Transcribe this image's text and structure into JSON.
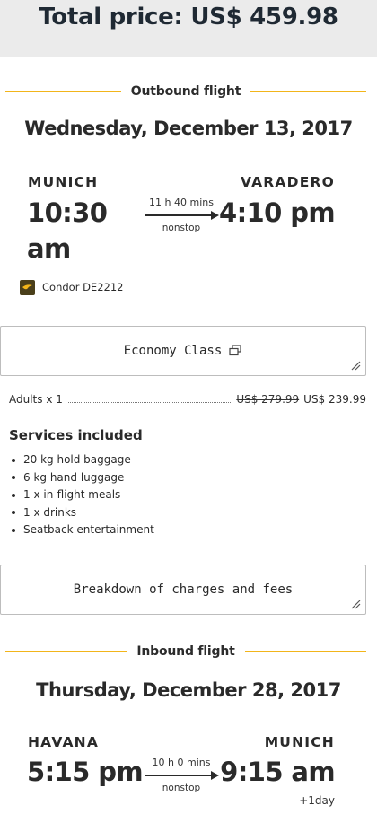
{
  "total": {
    "label": "Total price: US$ 459.98"
  },
  "outbound": {
    "section_label": "Outbound flight",
    "date": "Wednesday, December 13, 2017",
    "origin_city": "MUNICH",
    "origin_time": "10:30 am",
    "dest_city": "VARADERO",
    "dest_time": "4:10 pm",
    "duration": "11 h 40 mins",
    "stops": "nonstop",
    "airline": "Condor DE2212"
  },
  "cabin": {
    "label": "Economy Class"
  },
  "fare": {
    "passengers": "Adults x 1",
    "old_price": "US$ 279.99",
    "new_price": "US$ 239.99"
  },
  "services": {
    "title": "Services included",
    "items": [
      "20 kg hold baggage",
      "6 kg hand luggage",
      "1 x in-flight meals",
      "1 x drinks",
      "Seatback entertainment"
    ]
  },
  "breakdown": {
    "label": "Breakdown of charges and fees"
  },
  "inbound": {
    "section_label": "Inbound flight",
    "date": "Thursday, December 28, 2017",
    "origin_city": "HAVANA",
    "origin_time": "5:15 pm",
    "dest_city": "MUNICH",
    "dest_time": "9:15 am",
    "duration": "10 h 0 mins",
    "stops": "nonstop",
    "day_offset": "+1day"
  },
  "colors": {
    "accent": "#f2b51a",
    "text": "#2a2a2a",
    "total_bg": "#ebebeb"
  },
  "icons": {
    "external_link": "external-link-icon",
    "resize": "resize-grip-icon",
    "airline": "condor-logo-icon"
  }
}
